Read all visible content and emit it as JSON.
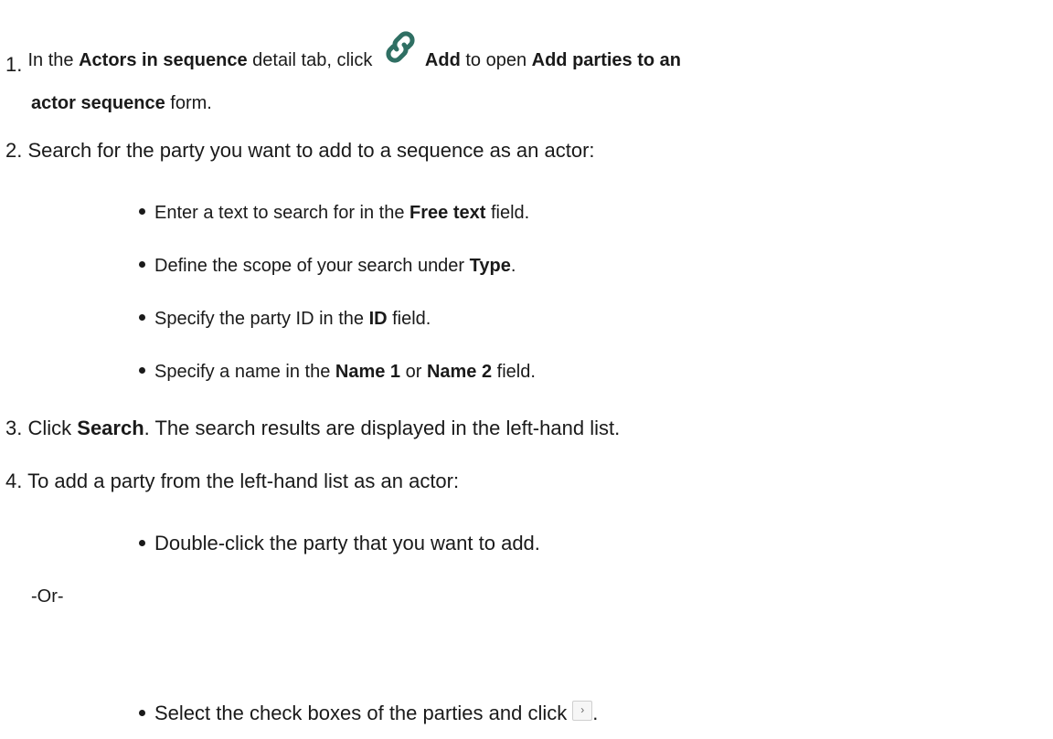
{
  "steps": [
    {
      "num": "1.",
      "t1": "In the ",
      "b1": "Actors in sequence",
      "t2": " detail tab, click ",
      "b2": "Add",
      "t3": " to open ",
      "b3": "Add parties to an",
      "cont_b": "actor sequence",
      "cont_t": " form."
    },
    {
      "num": "2.",
      "text": "Search for the party you want to add to a sequence as an actor:"
    },
    {
      "num": "3.",
      "t1": "Click ",
      "b1": "Search",
      "t2": ". The search results are displayed in the left-hand list."
    },
    {
      "num": "4.",
      "text": "To add a party from the left-hand list as an actor:"
    }
  ],
  "bullets_search": [
    {
      "t1": "Enter a text to search for in the ",
      "b1": "Free text",
      "t2": " field."
    },
    {
      "t1": "Define the scope of your search under ",
      "b1": "Type",
      "t2": "."
    },
    {
      "t1": "Specify the party ID in the ",
      "b1": "ID",
      "t2": " field."
    },
    {
      "t1": "Specify a name in the ",
      "b1": "Name 1",
      "t2": " or ",
      "b2": "Name 2",
      "t3": " field."
    }
  ],
  "bullet_add_1": "Double-click the party that you want to add.",
  "or_text": "-Or-",
  "bullet_add_2": "Select the check boxes of the parties and click",
  "bullet_add_2_end": ".",
  "chevron_glyph": "›",
  "icons": {
    "add_icon": "chain-link-icon",
    "move_right_icon": "chevron-right-icon"
  },
  "colors": {
    "text": "#1a1a1a",
    "icon": "#2f6f63"
  }
}
